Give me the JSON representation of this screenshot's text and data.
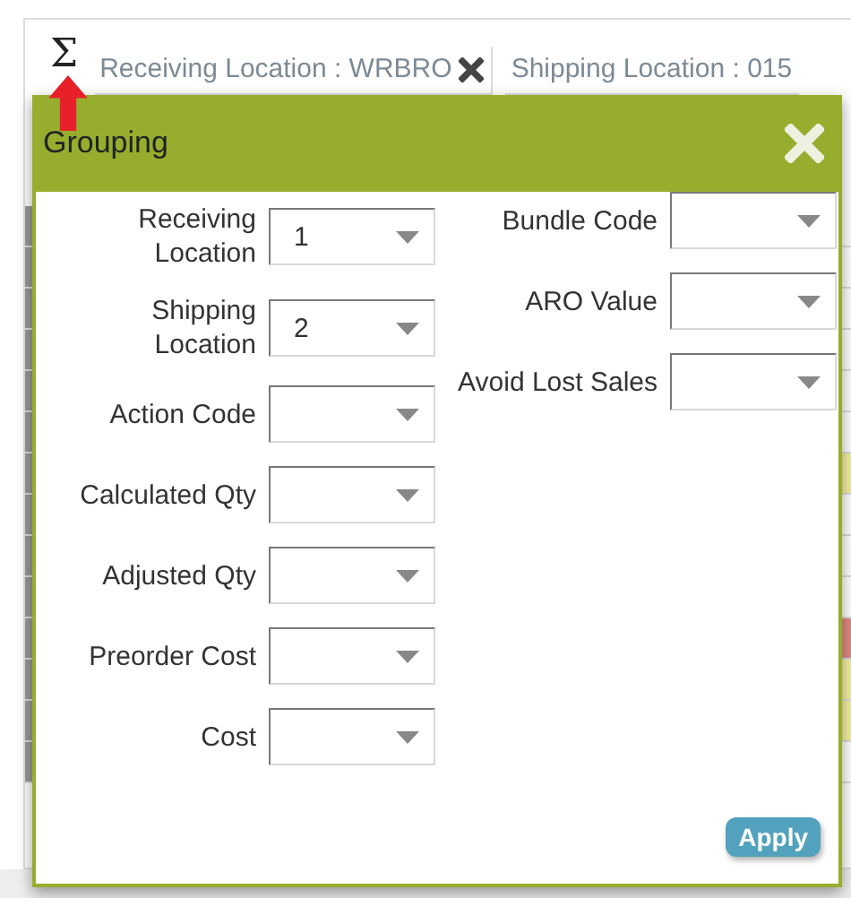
{
  "toolbar": {
    "sigma": "Σ",
    "filters": [
      {
        "text": "Receiving Location : WRBRO",
        "removable": true
      },
      {
        "text": "Shipping Location : 015",
        "removable": false
      }
    ]
  },
  "grid_rows": [
    {},
    {},
    {},
    {},
    {},
    {},
    {
      "color": "#f3f0a0"
    },
    {},
    {},
    {},
    {
      "color": "#e08a84"
    },
    {
      "color": "#f3f0a0"
    },
    {
      "color": "#f3f0a0"
    },
    {}
  ],
  "dialog": {
    "title": "Grouping",
    "left_fields": [
      {
        "label": "Receiving Location",
        "value": "1"
      },
      {
        "label": "Shipping Location",
        "value": "2"
      },
      {
        "label": "Action Code"
      },
      {
        "label": "Calculated Qty"
      },
      {
        "label": "Adjusted Qty"
      },
      {
        "label": "Preorder Cost"
      },
      {
        "label": "Cost"
      }
    ],
    "right_fields": [
      {
        "label": "Bundle Code"
      },
      {
        "label": "ARO Value"
      },
      {
        "label": "Avoid Lost Sales"
      }
    ],
    "apply": "Apply"
  }
}
